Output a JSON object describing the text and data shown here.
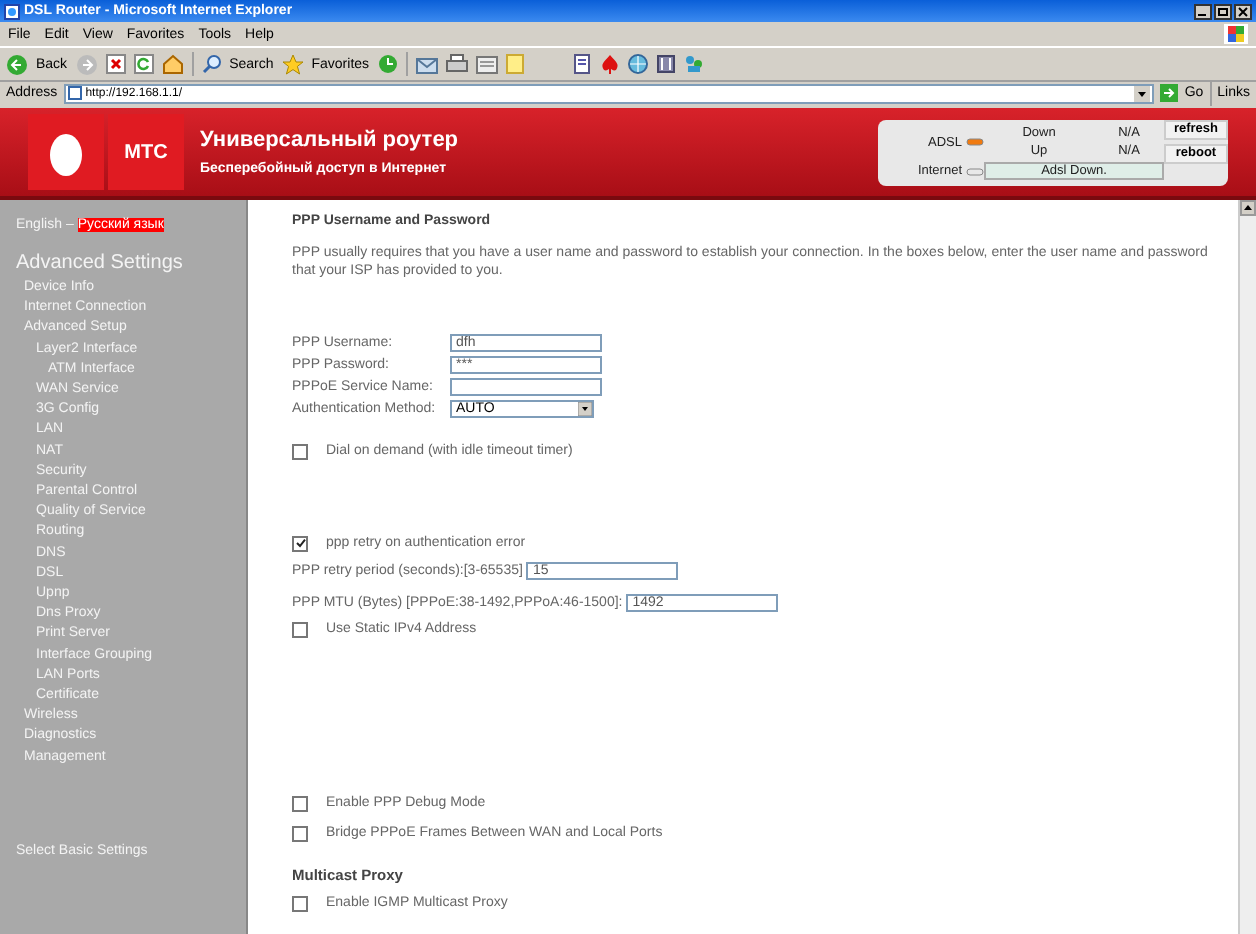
{
  "window": {
    "title": "DSL Router - Microsoft Internet Explorer"
  },
  "menu": [
    "File",
    "Edit",
    "View",
    "Favorites",
    "Tools",
    "Help"
  ],
  "toolbar": {
    "back": "Back",
    "search": "Search",
    "favorites": "Favorites"
  },
  "address": {
    "label": "Address",
    "url": "http://192.168.1.1/",
    "go": "Go",
    "links": "Links"
  },
  "header": {
    "logo": "МТС",
    "title": "Универсальный роутер",
    "subtitle": "Бесперебойный доступ в Интернет",
    "status": {
      "adsl_label": "ADSL",
      "down_label": "Down",
      "down_value": "N/A",
      "up_label": "Up",
      "up_value": "N/A",
      "internet_label": "Internet",
      "state": "Adsl Down."
    },
    "buttons": [
      "refresh",
      "reboot"
    ]
  },
  "languages": [
    {
      "label": "English",
      "selected": false
    },
    {
      "label": "Русский язык",
      "selected": true
    }
  ],
  "language_separator": "–",
  "sidebar": {
    "heading": "Advanced Settings",
    "items": [
      {
        "label": "Device Info"
      },
      {
        "label": "Internet Connection"
      },
      {
        "label": "Advanced Setup",
        "children": [
          {
            "label": "Layer2 Interface",
            "children": [
              {
                "label": "ATM Interface"
              }
            ]
          },
          {
            "label": "WAN Service"
          },
          {
            "label": "3G Config"
          },
          {
            "label": "LAN"
          },
          {
            "label": "NAT"
          },
          {
            "label": "Security"
          },
          {
            "label": "Parental Control"
          },
          {
            "label": "Quality of Service"
          },
          {
            "label": "Routing"
          },
          {
            "label": "DNS"
          },
          {
            "label": "DSL"
          },
          {
            "label": "Upnp"
          },
          {
            "label": "Dns Proxy"
          },
          {
            "label": "Print Server"
          },
          {
            "label": "Interface Grouping"
          },
          {
            "label": "LAN Ports"
          },
          {
            "label": "Certificate"
          }
        ]
      },
      {
        "label": "Wireless"
      },
      {
        "label": "Diagnostics"
      },
      {
        "label": "Management"
      }
    ],
    "footer": "Select Basic Settings"
  },
  "main": {
    "title": "PPP Username and Password",
    "intro": "PPP usually requires that you have a user name and password to establish your connection. In the boxes below, enter the user name and password that your ISP has provided to you.",
    "groups": [
      [
        {
          "kind": "text",
          "label": "PPP Username:",
          "value": "dfh"
        },
        {
          "kind": "text",
          "label": "PPP Password:",
          "value": "***"
        },
        {
          "kind": "text",
          "label": "PPPoE Service Name:"
        },
        {
          "kind": "select",
          "label": "Authentication Method:",
          "value": "AUTO"
        }
      ],
      [
        {
          "kind": "checkbox",
          "label": "Dial on demand (with idle timeout timer)",
          "checked": false
        }
      ],
      [
        {
          "kind": "checkbox",
          "label": "ppp retry on authentication error",
          "checked": true
        },
        {
          "kind": "inline",
          "label": "PPP retry period (seconds):[3-65535]",
          "value": "15"
        }
      ],
      [
        {
          "kind": "inline",
          "label": "PPP MTU (Bytes) [PPPoE:38-1492,PPPoA:46-1500]:",
          "value": "1492"
        },
        {
          "kind": "checkbox",
          "label": "Use Static IPv4 Address",
          "checked": false
        }
      ],
      [
        {
          "kind": "checkbox",
          "label": "Enable PPP Debug Mode",
          "checked": false
        },
        {
          "kind": "checkbox",
          "label": "Bridge PPPoE Frames Between WAN and Local Ports",
          "checked": false
        }
      ],
      [
        {
          "kind": "heading",
          "label": "Multicast Proxy"
        },
        {
          "kind": "checkbox",
          "label": "Enable IGMP Multicast Proxy",
          "checked": false
        }
      ]
    ]
  }
}
